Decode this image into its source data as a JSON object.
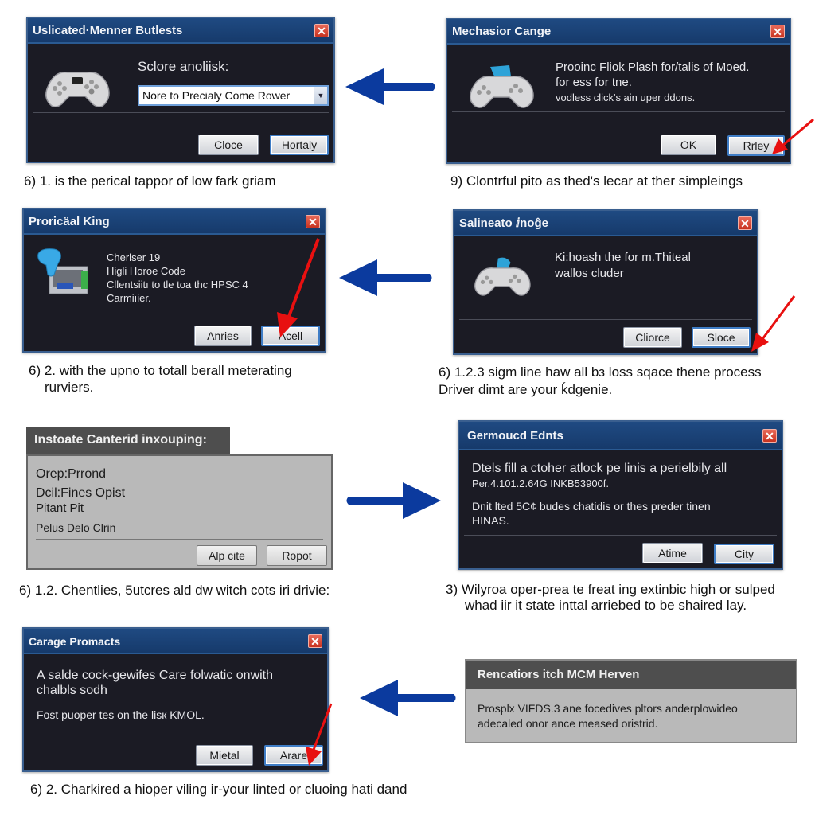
{
  "panels": [
    {
      "title": "Uslicated·Menner Butlests",
      "prompt": "Sclore anoliisk:",
      "dropdown_value": "Nore to Precialy Come Rower",
      "buttons": [
        "Cloce",
        "Hortaly"
      ],
      "icon": "gamepad-icon",
      "caption": "6) 1. is the perical tappor of low fark griam"
    },
    {
      "title": "Mechasior Cange",
      "lines": [
        "Prooinc Fliok Plash for/talis of Moed.",
        "for ess for tne.",
        "vodless click's ain uper ddons."
      ],
      "buttons": [
        "OK",
        "Rrley"
      ],
      "icon": "gamepad-icon",
      "caption": "9) Clontrful pito as thed's lecar at ther simpleings"
    },
    {
      "title": "Proricäal King",
      "lines": [
        "Cherlser 19",
        "Higli Horoe Code",
        "Cllentsiitı to tle toa thc HPSC 4",
        "Carmiıier."
      ],
      "buttons": [
        "Anries",
        "Acell"
      ],
      "icon": "hardware-device-icon",
      "caption_lines": [
        "6) 2. with the upno to totall berall meterating",
        "rurviers."
      ]
    },
    {
      "title": "Salineato ⅈnoĝe",
      "lines": [
        "Ki:hoash the for m.Thiteal",
        "wallos cluder"
      ],
      "buttons": [
        "Cliorce",
        "Sloce"
      ],
      "icon": "gamepad-icon",
      "caption_lines": [
        "6) 1.2.3 sigm line haw all bз loss sqace thene process",
        "Driver dimt are your ḱdgenie."
      ]
    },
    {
      "title": "Instoate Canterid inxouping:",
      "lines": [
        "Orep:Prrond",
        "Dcil:Fines Opist",
        "Pitant Pit",
        "Pelus Delo Clrin"
      ],
      "buttons": [
        "Alp cite",
        "Ropot"
      ],
      "caption": "6) 1.2. Chentlies, 5utcres ald dw witch cots iri drivie:"
    },
    {
      "title": "Germoucd Ednts",
      "lines": [
        "Dtels fill a ctoher atlock pe linis a perielbily all",
        "Per.4.101.2.64G INKB53900f.",
        "Dnit lted 5C¢ budes chatidis or thes preder tinen",
        "HINAS."
      ],
      "buttons": [
        "Atime",
        "City"
      ],
      "caption_lines": [
        "3) Wilyroa oper-prea te freat ing extinbic high or sulped",
        "whad iir it state inttal arriebed to be shaired lay."
      ]
    },
    {
      "title": "Carage Promacts",
      "lines": [
        "A salde cock-gewifes Care folwatic onwith",
        "chalbls sodh",
        "Fost puoper tes on the lisк KMOL."
      ],
      "buttons": [
        "Mietal",
        "Arare"
      ],
      "caption": "6) 2. Charkired a hioper viling ir-your linted or cluoing hati dand"
    },
    {
      "title": "Rencatiors itch MCM Herven",
      "lines": [
        "Prosplx VIFDS.3 ane focedives pltors anderplowideo",
        "adecaled onor ance meased oristrid."
      ]
    }
  ],
  "colors": {
    "arrow_blue": "#0b3a9e",
    "pointer_red": "#e81010",
    "titlebar_blue": "#1c4478",
    "dialog_dark": "#1b1b24"
  }
}
